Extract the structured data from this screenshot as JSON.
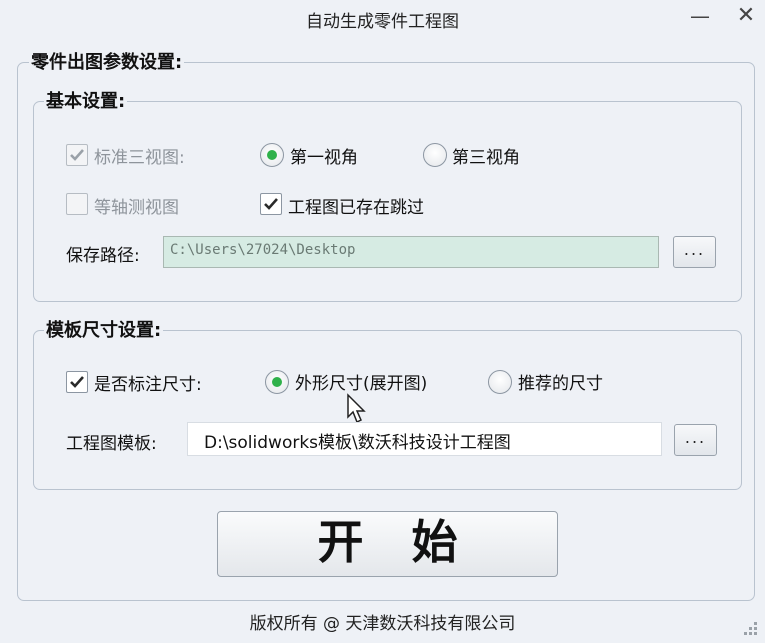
{
  "window": {
    "title": "自动生成零件工程图",
    "minimize_glyph": "—",
    "close_glyph": "✕"
  },
  "main_group": {
    "title": "零件出图参数设置:"
  },
  "basic_group": {
    "title": "基本设置:",
    "standard_views": {
      "label": "标准三视图:",
      "checked": true,
      "disabled": true
    },
    "first_angle": {
      "label": "第一视角",
      "selected": true
    },
    "third_angle": {
      "label": "第三视角",
      "selected": false
    },
    "isometric_view": {
      "label": "等轴测视图",
      "checked": false,
      "disabled": true
    },
    "skip_existing": {
      "label": "工程图已存在跳过",
      "checked": true
    },
    "save_path": {
      "label": "保存路径:",
      "value": "C:\\Users\\27024\\Desktop"
    },
    "browse_label": "..."
  },
  "template_group": {
    "title": "模板尺寸设置:",
    "annotate_dims": {
      "label": "是否标注尺寸:",
      "checked": true
    },
    "outline_dims": {
      "label": "外形尺寸(展开图)",
      "selected": true
    },
    "recommended_dims": {
      "label": "推荐的尺寸",
      "selected": false
    },
    "template": {
      "label": "工程图模板:",
      "value": "D:\\solidworks模板\\数沃科技设计工程图"
    },
    "browse_label": "..."
  },
  "start_button": {
    "label": "开始"
  },
  "footer": {
    "text": "版权所有 @ 天津数沃科技有限公司"
  },
  "colors": {
    "accent_green": "#2fb14a",
    "path_bg": "#d6ebe3",
    "window_bg": "#eef1f6"
  }
}
